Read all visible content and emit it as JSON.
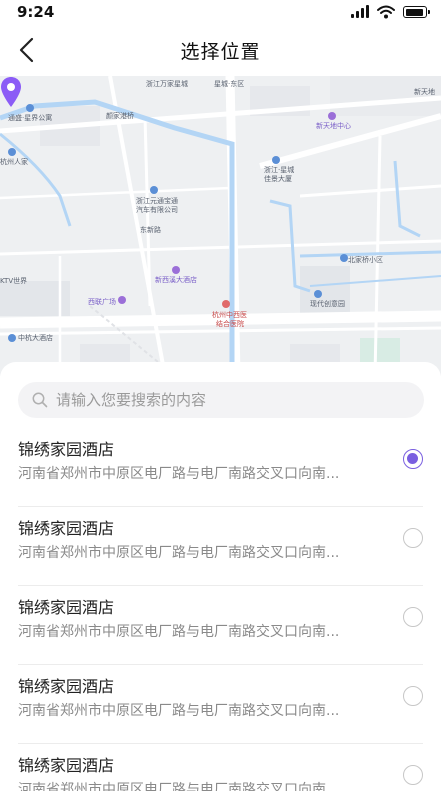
{
  "status_bar": {
    "time": "9:24"
  },
  "header": {
    "title": "选择位置"
  },
  "map": {
    "labels": [
      "浙江万家星城",
      "星城·东区",
      "新天地",
      "通盛·星界公寓",
      "颜家港桥",
      "新天地中心",
      "浙江·星城",
      "佳景大厦",
      "浙江元通宝通",
      "汽车有限公司",
      "东新路",
      "杭州人家",
      "新西溪大酒店",
      "北家桥小区",
      "KTV世界",
      "西联广场",
      "现代创意园",
      "杭州中西医",
      "结合医院",
      "中杭大酒店"
    ],
    "pin_color": "#8b5cf6"
  },
  "search": {
    "placeholder": "请输入您要搜索的内容",
    "value": ""
  },
  "results": [
    {
      "name": "锦绣家园酒店",
      "address": "河南省郑州市中原区电厂路与电厂南路交叉口向南...",
      "selected": true
    },
    {
      "name": "锦绣家园酒店",
      "address": "河南省郑州市中原区电厂路与电厂南路交叉口向南...",
      "selected": false
    },
    {
      "name": "锦绣家园酒店",
      "address": "河南省郑州市中原区电厂路与电厂南路交叉口向南...",
      "selected": false
    },
    {
      "name": "锦绣家园酒店",
      "address": "河南省郑州市中原区电厂路与电厂南路交叉口向南...",
      "selected": false
    },
    {
      "name": "锦绣家园酒店",
      "address": "河南省郑州市中原区电厂路与电厂南路交叉口向南...",
      "selected": false
    }
  ],
  "colors": {
    "accent": "#7a5fe0",
    "water": "#b3d5f5"
  },
  "icons": [
    "back-arrow-icon",
    "signal-icon",
    "wifi-icon",
    "battery-icon",
    "location-pin-icon",
    "search-icon",
    "radio-checked-icon",
    "radio-unchecked-icon"
  ]
}
